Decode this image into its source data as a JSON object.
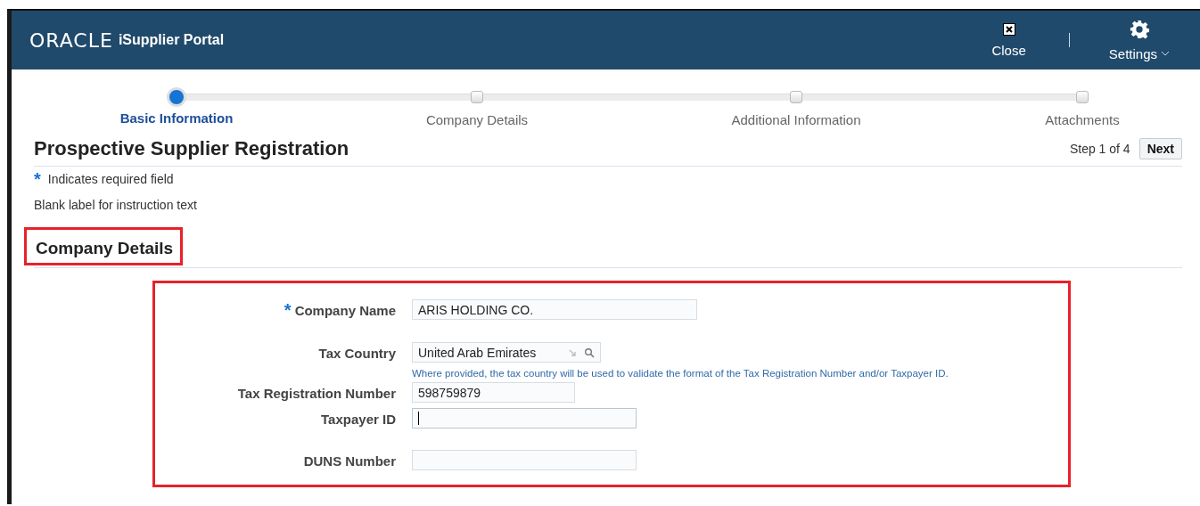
{
  "header": {
    "logo": "ORACLE",
    "product": "iSupplier Portal",
    "actions": [
      {
        "kind": "close",
        "label": "Close"
      },
      {
        "kind": "settings",
        "label": "Settings"
      }
    ]
  },
  "steps": [
    {
      "label": "Basic Information",
      "selected": true
    },
    {
      "label": "Company Details",
      "selected": false
    },
    {
      "label": "Additional Information",
      "selected": false
    },
    {
      "label": "Attachments",
      "selected": false
    }
  ],
  "page": {
    "title": "Prospective Supplier Registration",
    "step_text": "Step 1 of 4",
    "next_button": "Next",
    "required_mark": "*",
    "required_note": "Indicates required field",
    "instruction": "Blank label for instruction text"
  },
  "section": {
    "title": "Company Details",
    "highlighted": true
  },
  "form": {
    "highlighted": true,
    "fields": [
      {
        "label": "Company Name",
        "required": true,
        "value": "ARIS HOLDING CO.",
        "kind": "text",
        "focused": false
      },
      {
        "label": "Tax Country",
        "required": false,
        "value": "United Arab Emirates",
        "kind": "lookup",
        "hint": "Where provided, the tax country will be used to validate the format of the Tax Registration Number and/or Taxpayer ID."
      },
      {
        "label": "Tax Registration Number",
        "required": false,
        "value": "598759879",
        "kind": "text",
        "focused": false
      },
      {
        "label": "Taxpayer ID",
        "required": false,
        "kind": "text",
        "focused": true
      },
      {
        "label": "DUNS Number",
        "required": false,
        "kind": "text",
        "focused": false
      }
    ]
  }
}
